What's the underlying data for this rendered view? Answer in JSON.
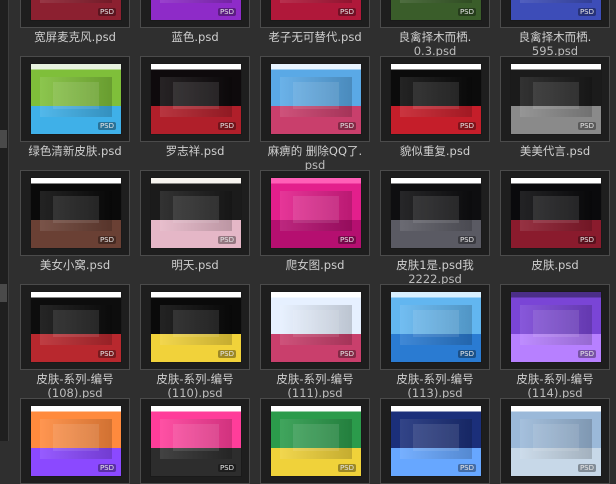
{
  "file_grid": {
    "badge": "PSD",
    "tiles": [
      {
        "name": "宽屏麦克风.psd",
        "colors": [
          "#dcdcdc",
          "#2b2b2b",
          "#8c2030"
        ]
      },
      {
        "name": "蓝色.psd",
        "colors": [
          "#ffffff",
          "#2a1d8c",
          "#8e2bc8"
        ]
      },
      {
        "name": "老子无可替代.psd",
        "colors": [
          "#ffffff",
          "#150b0f",
          "#b0183a"
        ]
      },
      {
        "name": "良禽择木而栖.",
        "name2": "0.3.psd",
        "colors": [
          "#ffffff",
          "#050506",
          "#3a5d2a"
        ]
      },
      {
        "name": "良禽择木而栖.",
        "name2": "595.psd",
        "colors": [
          "#ffffff",
          "#07081c",
          "#3d4db8"
        ]
      },
      {
        "name": "绿色清新皮肤.psd",
        "colors": [
          "#e8f2e0",
          "#7fbf3a",
          "#3fb0e8"
        ]
      },
      {
        "name": "罗志祥.psd",
        "colors": [
          "#ffffff",
          "#0e0a0c",
          "#b01f2a"
        ]
      },
      {
        "name": "麻痹的 删除QQ了.",
        "name2": "psd",
        "colors": [
          "#e9f4ff",
          "#5aa9e6",
          "#c93f6c"
        ]
      },
      {
        "name": "貌似重复.psd",
        "colors": [
          "#ffffff",
          "#0b0b0b",
          "#c51e2a"
        ]
      },
      {
        "name": "美美代言.psd",
        "colors": [
          "#ffffff",
          "#1b1b1b",
          "#8a8a8a"
        ]
      },
      {
        "name": "美女小窝.psd",
        "colors": [
          "#ffffff",
          "#0a0a0a",
          "#6a4034"
        ]
      },
      {
        "name": "明天.psd",
        "colors": [
          "#f7f4ef",
          "#1b1b1b",
          "#e5b7c7"
        ]
      },
      {
        "name": "爬女图.psd",
        "colors": [
          "#ff5fb7",
          "#e31f8c",
          "#b50f70"
        ]
      },
      {
        "name": "皮肤1是.psd我",
        "name2": "2222.psd",
        "colors": [
          "#ffffff",
          "#0e0e10",
          "#5a5a63"
        ]
      },
      {
        "name": "皮肤.psd",
        "colors": [
          "#ffffff",
          "#0a0a0c",
          "#8a1b2d"
        ]
      },
      {
        "name": "皮肤-系列-编号",
        "name2": "(108).psd",
        "colors": [
          "#ffffff",
          "#0d0d0d",
          "#b8282e"
        ]
      },
      {
        "name": "皮肤-系列-编号",
        "name2": "(110).psd",
        "colors": [
          "#ffffff",
          "#0a0a0a",
          "#f1d23a"
        ]
      },
      {
        "name": "皮肤-系列-编号",
        "name2": "(111).psd",
        "colors": [
          "#ffffff",
          "#e6f0ff",
          "#c93f6c"
        ]
      },
      {
        "name": "皮肤-系列-编号",
        "name2": "(113).psd",
        "colors": [
          "#d8f0ff",
          "#62b6f0",
          "#2a7bd2"
        ]
      },
      {
        "name": "皮肤-系列-编号",
        "name2": "(114).psd",
        "colors": [
          "#4b2e88",
          "#7a45d6",
          "#b780ff"
        ]
      },
      {
        "name": "",
        "colors": [
          "#ffffff",
          "#ff8a3d",
          "#8b49ff"
        ]
      },
      {
        "name": "",
        "colors": [
          "#ffffff",
          "#ff3d9a",
          "#2d2d2d"
        ]
      },
      {
        "name": "",
        "colors": [
          "#ffffff",
          "#2b9b4b",
          "#f0d23a"
        ]
      },
      {
        "name": "",
        "colors": [
          "#ffffff",
          "#1b2f7a",
          "#67a7ff"
        ]
      },
      {
        "name": "",
        "colors": [
          "#ffffff",
          "#9bb9d9",
          "#c7d8e8"
        ]
      }
    ]
  }
}
